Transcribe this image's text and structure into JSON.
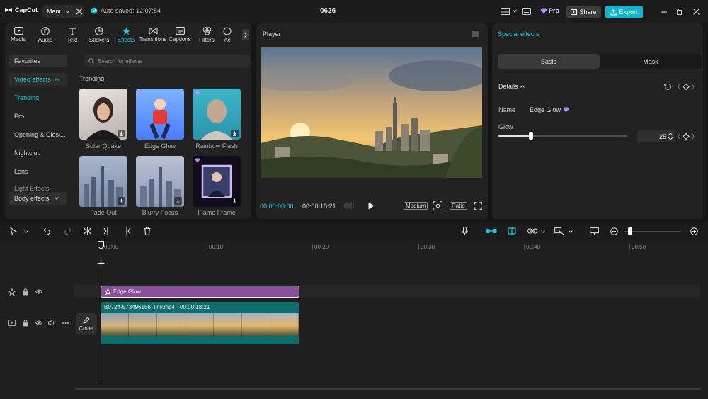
{
  "app": {
    "logo": "CapCut",
    "menu_label": "Menu",
    "autosave": "Auto saved: 12:07:54",
    "project_title": "0626",
    "pro_label": "Pro",
    "share_label": "Share",
    "export_label": "Export"
  },
  "media_tabs": [
    {
      "label": "Media",
      "icon": "media-icon"
    },
    {
      "label": "Audio",
      "icon": "audio-icon"
    },
    {
      "label": "Text",
      "icon": "text-icon"
    },
    {
      "label": "Stickers",
      "icon": "stickers-icon"
    },
    {
      "label": "Effects",
      "icon": "effects-icon"
    },
    {
      "label": "Transitions",
      "icon": "transitions-icon"
    },
    {
      "label": "Captions",
      "icon": "captions-icon"
    },
    {
      "label": "Filters",
      "icon": "filters-icon"
    },
    {
      "label": "Ac",
      "icon": "adjust-icon"
    }
  ],
  "categories": {
    "favorites": "Favorites",
    "video_effects": "Video effects",
    "subs": [
      "Trending",
      "Pro",
      "Opening & Closi...",
      "Nightclub",
      "Lens",
      "Light Effects"
    ],
    "body_effects": "Body effects"
  },
  "search": {
    "placeholder": "Search for effects"
  },
  "trending_label": "Trending",
  "effects": [
    {
      "label": "Solar Quake"
    },
    {
      "label": "Edge Glow"
    },
    {
      "label": "Rainbow Flash"
    },
    {
      "label": "Fade Out"
    },
    {
      "label": "Blurry Focus"
    },
    {
      "label": "Flame Frame"
    }
  ],
  "player": {
    "title": "Player",
    "current_time": "00:00:00:00",
    "total_time": "00:00:18:21",
    "quality": "Medium",
    "ratio": "Ratio"
  },
  "special_effects": {
    "title": "Special effects",
    "tabs": [
      "Basic",
      "Mask"
    ],
    "details_label": "Details",
    "name_label": "Name",
    "name_value": "Edge Glow",
    "glow_label": "Glow",
    "glow_value": "25",
    "glow_level": 25
  },
  "timeline": {
    "ruler": [
      "00:00",
      "00:10",
      "00:20",
      "00:30",
      "00:40",
      "00:50"
    ],
    "effect_clip": "Edge Glow",
    "video_clip_name": "B0724-573496156_tiny.mp4",
    "video_clip_duration": "00:00:18:21",
    "cover_label": "Cover"
  },
  "colors": {
    "accent": "#1fc6d9",
    "effect_clip": "#8a4f9a",
    "video_clip": "#0f6d6d",
    "pro": "#b48cff"
  }
}
